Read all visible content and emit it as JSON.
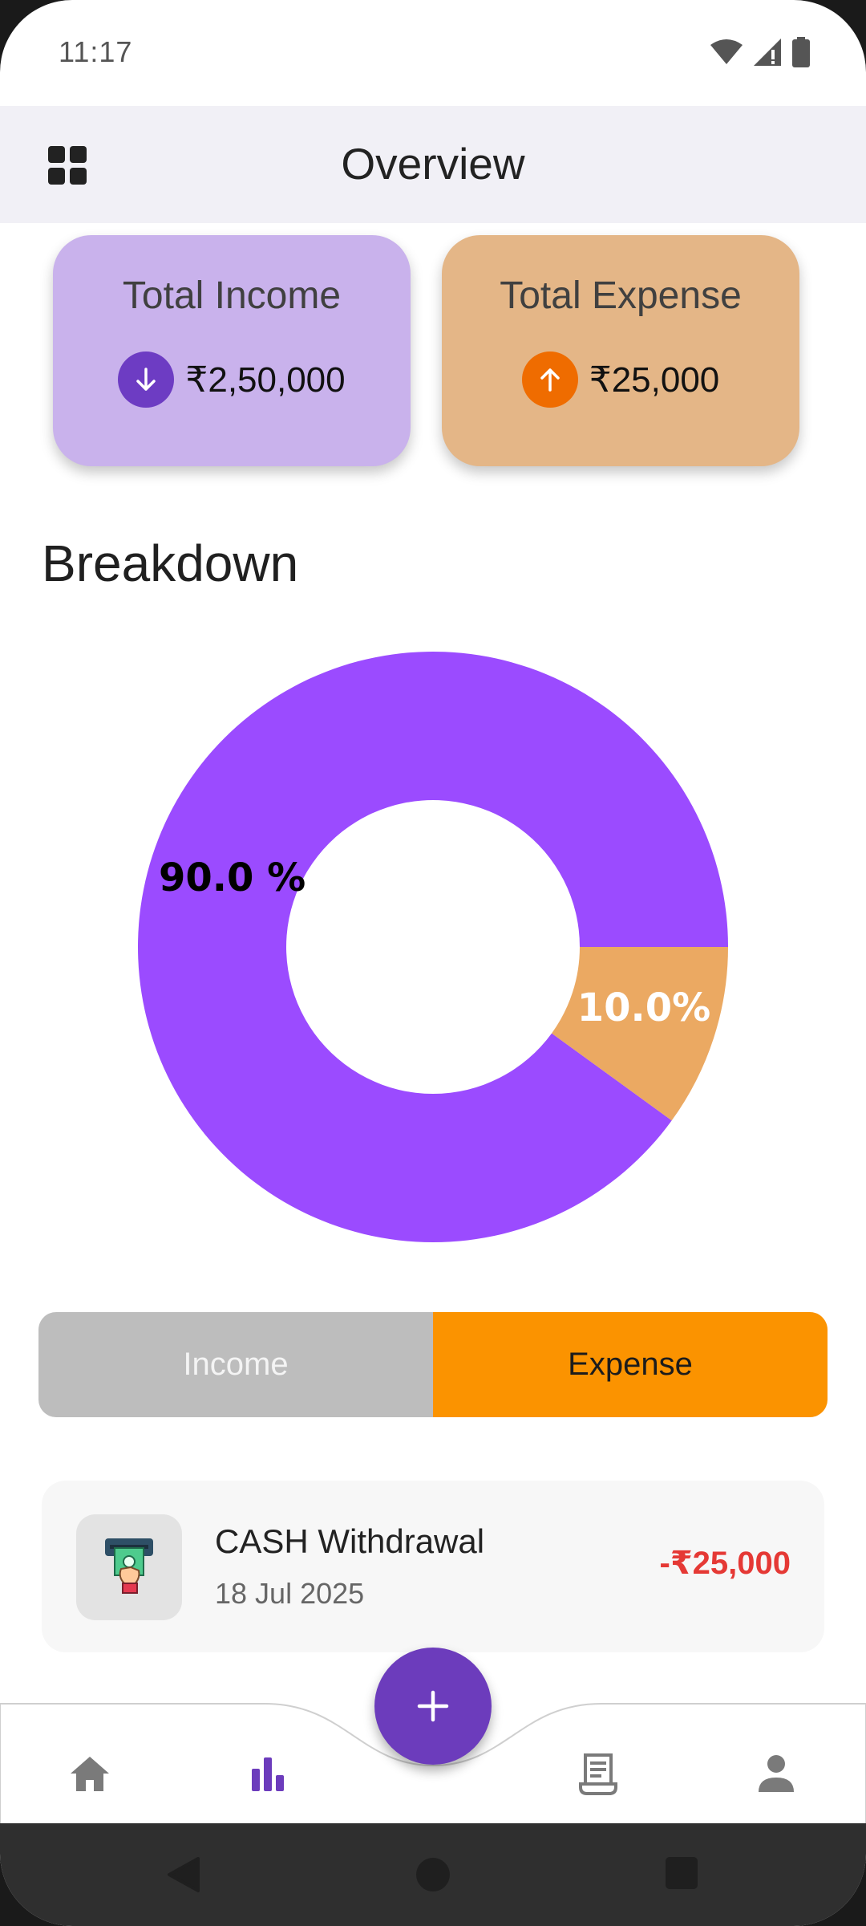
{
  "status_bar": {
    "time": "11:17"
  },
  "app_bar": {
    "title": "Overview",
    "menu_icon": "grid-icon"
  },
  "summary": {
    "income": {
      "title": "Total Income",
      "amount": "₹2,50,000",
      "icon": "arrow-down-icon",
      "color": "#c9b2ec"
    },
    "expense": {
      "title": "Total Expense",
      "amount": "₹25,000",
      "icon": "arrow-up-icon",
      "color": "#e4b687"
    }
  },
  "breakdown": {
    "title": "Breakdown"
  },
  "chart_data": {
    "type": "pie",
    "donut": true,
    "categories": [
      "Income",
      "Expense"
    ],
    "values": [
      90.0,
      10.0
    ],
    "labels": [
      "90.0 %",
      "10.0%"
    ],
    "colors": [
      "#9b4bff",
      "#eba962"
    ]
  },
  "toggle": {
    "income_label": "Income",
    "expense_label": "Expense",
    "selected": "Expense"
  },
  "transactions": [
    {
      "title": "CASH Withdrawal",
      "date": "18 Jul 2025",
      "amount": "-₹25,000",
      "icon": "atm-cash-icon"
    }
  ],
  "bottom_nav": {
    "items": [
      "home-icon",
      "stats-icon",
      "receipt-icon",
      "profile-icon"
    ],
    "active": "stats-icon",
    "fab_icon": "plus-icon"
  }
}
